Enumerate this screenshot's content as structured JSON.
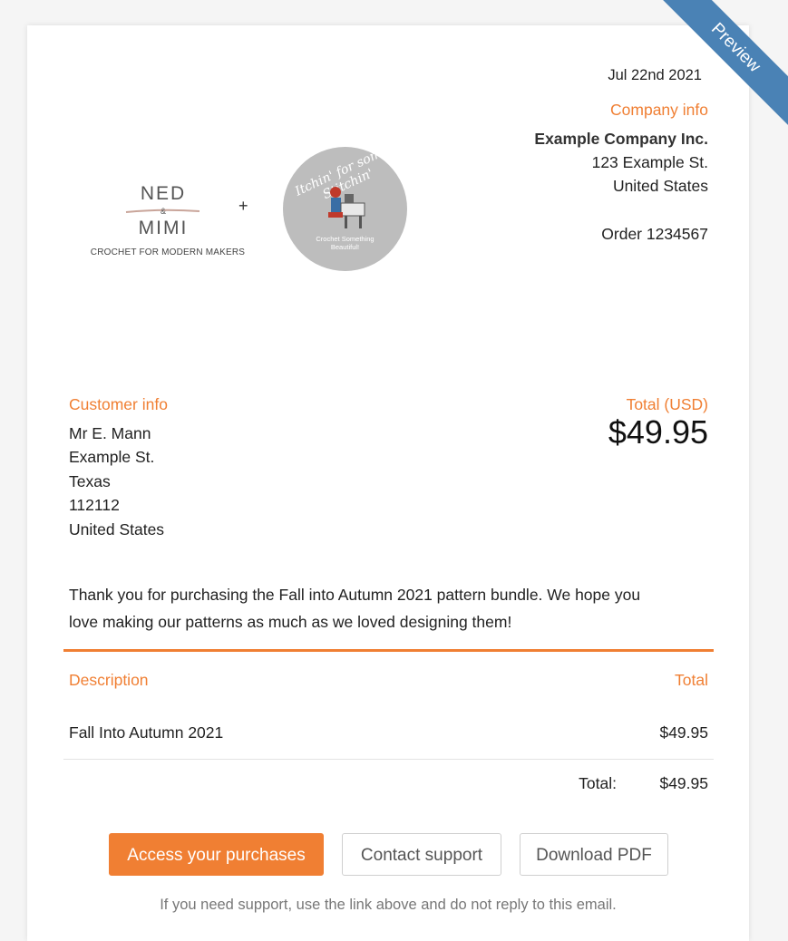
{
  "preview_ribbon": "Preview",
  "header": {
    "date": "Jul 22nd 2021",
    "company_heading": "Company info",
    "company_name": "Example Company Inc.",
    "company_street": "123 Example St.",
    "company_country": "United States",
    "order": "Order 1234567"
  },
  "logos": {
    "ned_top": "NED",
    "ned_amp": "&",
    "ned_bottom": "MIMI",
    "ned_tagline": "CROCHET FOR MODERN MAKERS",
    "plus": "+",
    "badge_script": "Itchin' for some Stitchin'",
    "badge_sub": "Crochet Something Beautiful!"
  },
  "customer": {
    "heading": "Customer info",
    "name": "Mr E. Mann",
    "street": "Example St.",
    "state": "Texas",
    "zip": "112112",
    "country": "United States"
  },
  "total": {
    "heading": "Total (USD)",
    "amount": "$49.95"
  },
  "message": {
    "line1": "Thank you for purchasing the Fall into Autumn 2021 pattern bundle.  We hope you",
    "line2": "love making our patterns as much as we loved designing them!"
  },
  "table": {
    "col_description": "Description",
    "col_total": "Total",
    "rows": [
      {
        "description": "Fall Into Autumn 2021",
        "total": "$49.95"
      }
    ],
    "summary_label": "Total:",
    "summary_value": "$49.95"
  },
  "buttons": {
    "access": "Access your purchases",
    "contact": "Contact support",
    "download": "Download PDF"
  },
  "footer_note": "If you need support, use the link above and do not reply to this email.",
  "colors": {
    "accent": "#f07f33",
    "ribbon": "#4a82b5"
  }
}
